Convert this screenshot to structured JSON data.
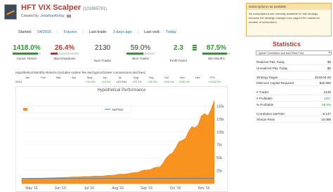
{
  "header": {
    "title": "HFT VIX Scalper",
    "system_id": "(101865781)",
    "creator_prefix": "Created by:",
    "creator_name": "JonathanKinlay"
  },
  "dates": {
    "started_label": "Started:",
    "started_value": "04/2016",
    "category": "Futures",
    "last_trade_label": "Last trade:",
    "last_trade_value": "3 days ago",
    "last_visit_label": "Last visit:",
    "last_visit_value": "Today"
  },
  "metrics": [
    {
      "value": "1418.0%",
      "label": "Cumul. Return",
      "style": "green",
      "bar": 0.9,
      "bar_color": "#2e9b2e"
    },
    {
      "value": "26.4%",
      "label": "Max Drawdown",
      "style": "red",
      "bar": 0.26,
      "bar_color": "#c0392b"
    },
    {
      "value": "2130",
      "label": "Num Trades",
      "style": "neutral",
      "bar": 0,
      "bar_color": "#999999"
    },
    {
      "value": "59.0%",
      "label": "Won Trades",
      "style": "neutral",
      "bar": 0.59,
      "bar_color": "#2e9b2e"
    },
    {
      "value": "2.3",
      "label": "Profit Factor",
      "style": "green",
      "bar": 0,
      "bar_color": "#2e9b2e"
    },
    {
      "value": "87.5%",
      "label": "Win Months",
      "style": "green",
      "bar": 0.875,
      "bar_color": "#2e9b2e"
    }
  ],
  "monthly_returns": {
    "title": "Hypothetical Monthly Returns (includes system fee and typical broker commissions and fees)",
    "headers": [
      "Jan",
      "Feb",
      "Mar",
      "Apr",
      "May",
      "Jun",
      "Jul",
      "Aug",
      "Sep",
      "Oct",
      "Nov",
      "Dec",
      "YTD"
    ],
    "year": "2014",
    "values": [
      "",
      "",
      "",
      "",
      "+10.5%",
      "+19.0%",
      "(13.0%)",
      "+43.2%",
      "+46.2%",
      "+196.4%",
      "+196.0%",
      "",
      "+1418.0%"
    ]
  },
  "chart": {
    "title": "Hypothetical Performance",
    "legend_system": "HFT VIX Scalper with commissions and fees",
    "legend_benchmark": "S&P500",
    "y_tick_labels": [
      "150k",
      "125k",
      "100k",
      "75k",
      "50k",
      "25k"
    ],
    "x_tick_labels": [
      "May '16",
      "Jun '16",
      "Jul '16",
      "Aug '16",
      "Sep '16",
      "Oct '16",
      "Nov '16"
    ],
    "accent": "#f7931e"
  },
  "chart_data": {
    "type": "area",
    "title": "Hypothetical Performance",
    "x": [
      "May '16",
      "Jun '16",
      "Jul '16",
      "Aug '16",
      "Sep '16",
      "Oct '16",
      "Nov '16",
      "Nov '16 end"
    ],
    "series": [
      {
        "name": "HFT VIX Scalper with commissions and fees",
        "values": [
          10000,
          11000,
          13000,
          15000,
          20000,
          32000,
          95000,
          152000
        ]
      },
      {
        "name": "S&P500",
        "values": [
          10000,
          10100,
          10300,
          10400,
          10350,
          10300,
          10400,
          10500
        ]
      }
    ],
    "ylim": [
      0,
      160000
    ],
    "y_ticks": [
      25000,
      50000,
      75000,
      100000,
      125000,
      150000
    ]
  },
  "subscriptions": {
    "heading": "Subscriptions not available",
    "text": "No subscriptions are currently available for this strategy because the strategy manager has capped the maximum number of subscribers."
  },
  "statistics": {
    "title": "Statistics",
    "select_value": "Typical Commission and AutoTrade Fees",
    "rows": [
      {
        "label": "Realized P&L Today",
        "value": "$0",
        "style": ""
      },
      {
        "label": "Unrealized P&L Today",
        "value": "$0",
        "style": ""
      },
      {
        "label": "Strategy began",
        "value": "2016-04-20",
        "style": ""
      },
      {
        "label": "Minimum Capital Required",
        "value": "$10,000",
        "style": ""
      },
      {
        "label": "# Trades",
        "value": "2130",
        "style": ""
      },
      {
        "label": "# Profitable",
        "value": "1257",
        "style": "green"
      },
      {
        "label": "% Profitable",
        "value": "59.0%",
        "style": "green"
      },
      {
        "label": "Correlation S&P500",
        "value": "-0.147",
        "style": ""
      },
      {
        "label": "Sharpe Ratio",
        "value": "10.086",
        "style": ""
      }
    ]
  }
}
